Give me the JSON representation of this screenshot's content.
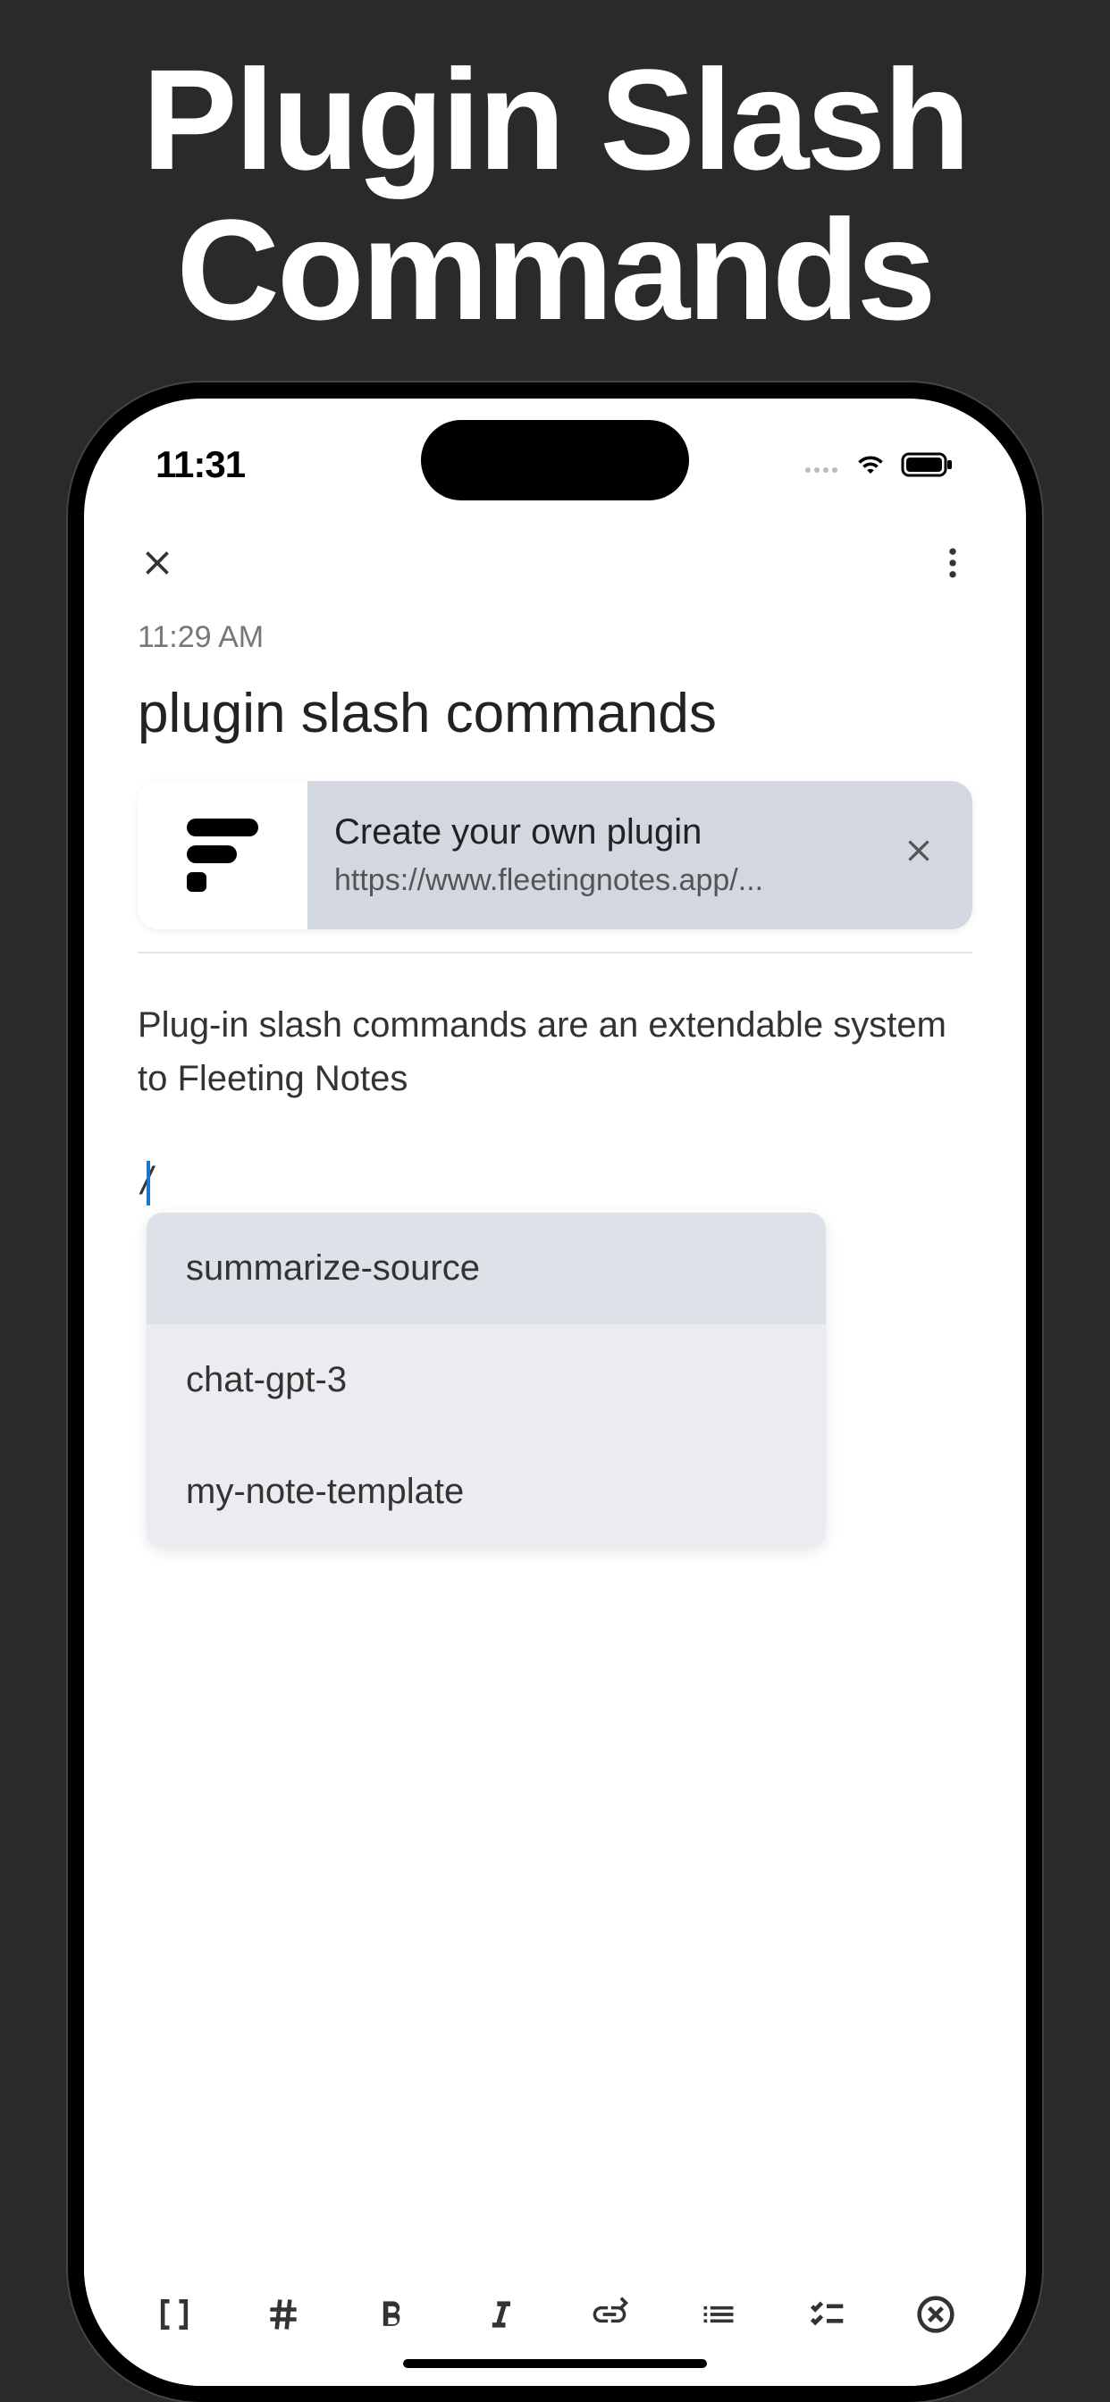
{
  "marketing": {
    "title_line1": "Plugin Slash",
    "title_line2": "Commands"
  },
  "status_bar": {
    "time": "11:31"
  },
  "note": {
    "timestamp": "11:29 AM",
    "title": "plugin slash commands",
    "body_text": "Plug-in slash commands are an extendable system to Fleeting Notes",
    "slash_char": "/"
  },
  "plugin_card": {
    "title": "Create your own plugin",
    "url": "https://www.fleetingnotes.app/..."
  },
  "commands": [
    {
      "label": "summarize-source",
      "selected": true
    },
    {
      "label": "chat-gpt-3",
      "selected": false
    },
    {
      "label": "my-note-template",
      "selected": false
    }
  ],
  "toolbar": {
    "icons": [
      "brackets",
      "hash",
      "bold",
      "italic",
      "link",
      "list",
      "checklist",
      "close-circle"
    ]
  }
}
